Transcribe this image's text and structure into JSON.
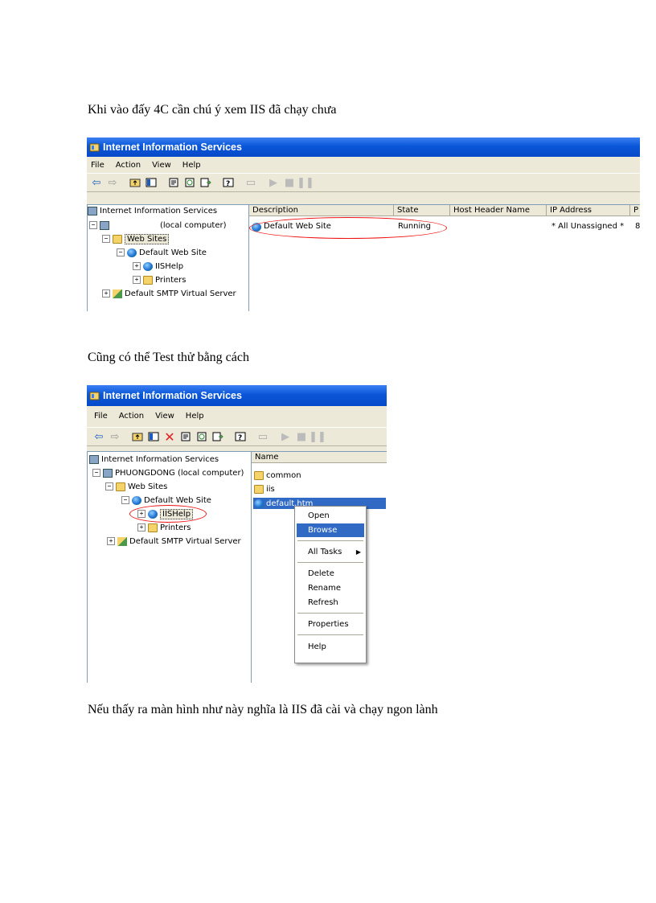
{
  "texts": {
    "p1": "Khi vào đấy 4C cần chú ý xem IIS đã chạy chưa",
    "p2": "Cũng có thể Test thử bằng cách",
    "p3": "Nếu thấy ra màn hình như này nghĩa là IIS đã cài và chạy ngon lành"
  },
  "shot1": {
    "title": "Internet Information Services",
    "menu": [
      "File",
      "Action",
      "View",
      "Help"
    ],
    "tree": {
      "root": "Internet Information Services",
      "computer": "(local computer)",
      "websites": "Web Sites",
      "default_site": "Default Web Site",
      "iishelp": "IISHelp",
      "printers": "Printers",
      "smtp": "Default SMTP Virtual Server"
    },
    "columns": [
      "Description",
      "State",
      "Host Header Name",
      "IP Address",
      "P"
    ],
    "row": {
      "description": "Default Web Site",
      "state": "Running",
      "host": "",
      "ip": "* All Unassigned *",
      "port": "8"
    }
  },
  "shot2": {
    "title": "Internet Information Services",
    "menu": [
      "File",
      "Action",
      "View",
      "Help"
    ],
    "tree": {
      "root": "Internet Information Services",
      "computer": "PHUONGDONG (local computer)",
      "websites": "Web Sites",
      "default_site": "Default Web Site",
      "iishelp": "IISHelp",
      "printers": "Printers",
      "smtp": "Default SMTP Virtual Server"
    },
    "column": "Name",
    "files": [
      "common",
      "iis",
      "default.htm"
    ],
    "context_menu": {
      "open": "Open",
      "browse": "Browse",
      "all_tasks": "All Tasks",
      "delete": "Delete",
      "rename": "Rename",
      "refresh": "Refresh",
      "properties": "Properties",
      "help": "Help"
    }
  },
  "colors": {
    "highlight_oval": "#e11111",
    "titlebar": "#0a56d8",
    "menu_selection": "#316ac5"
  }
}
